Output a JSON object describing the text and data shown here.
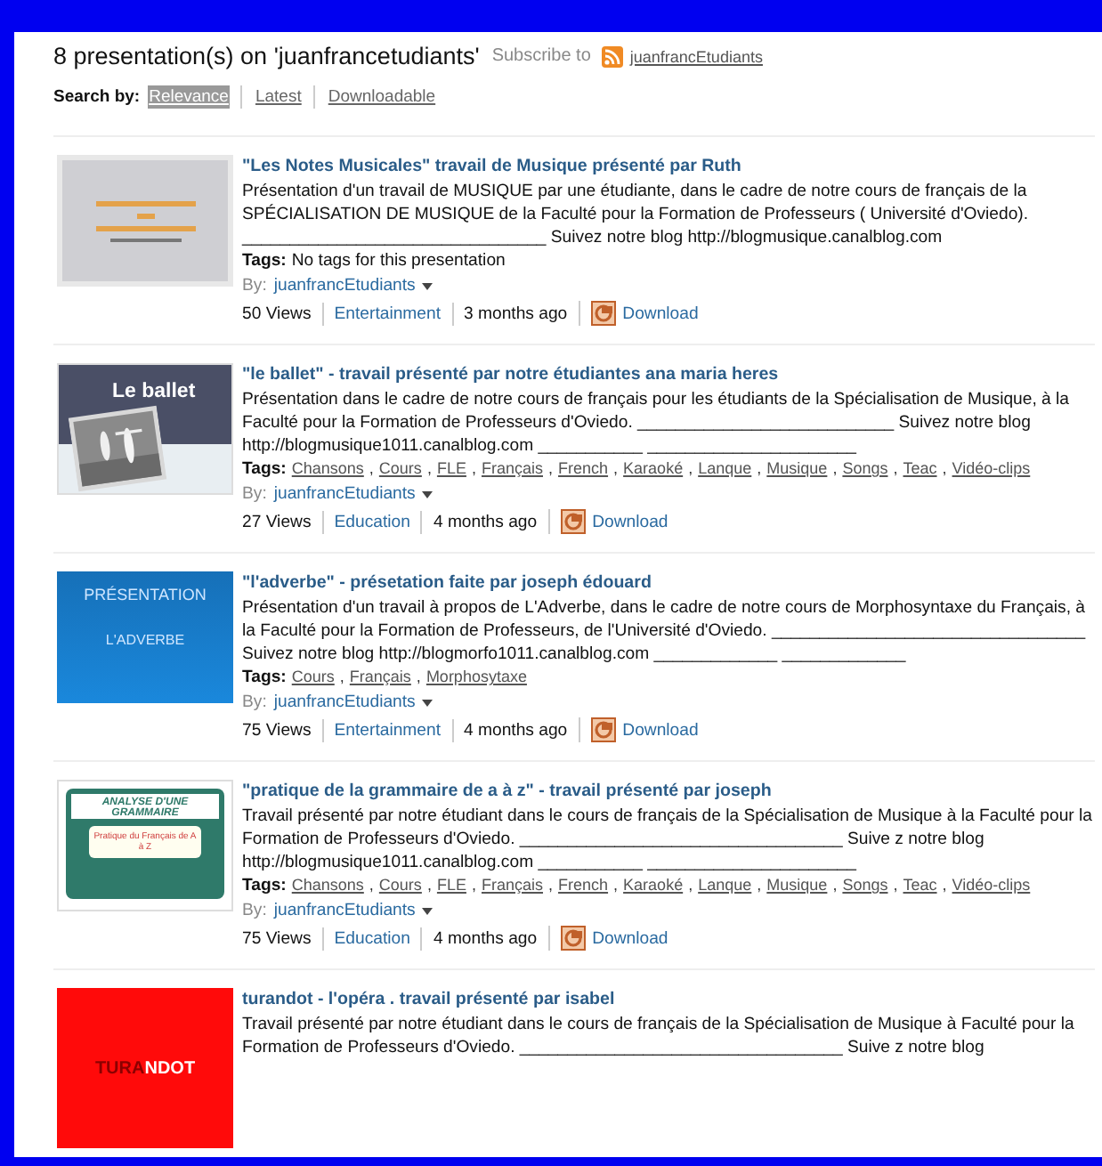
{
  "header": {
    "heading": "8 presentation(s) on 'juanfrancetudiants'",
    "subscribe_label": "Subscribe to",
    "subscribe_link": "juanfrancEtudiants"
  },
  "search": {
    "label": "Search by:",
    "options": [
      {
        "label": "Relevance",
        "selected": true
      },
      {
        "label": "Latest",
        "selected": false
      },
      {
        "label": "Downloadable",
        "selected": false
      }
    ]
  },
  "tag_separator": ",",
  "presentations": [
    {
      "thumb": {
        "kind": "notes"
      },
      "title": "\"Les Notes Musicales\" travail de Musique présenté par Ruth",
      "description": "Présentation d'un travail de MUSIQUE par une étudiante, dans le cadre de notre cours de français de la SPÉCIALISATION DE MUSIQUE de la Faculté pour la Formation de Professeurs ( Université d'Oviedo). ________________________________ Suivez notre blog http://blogmusique.canalblog.com",
      "tags_label": "Tags:",
      "no_tags": "No tags for this presentation",
      "by_label": "By:",
      "author": "juanfrancEtudiants",
      "views": "50 Views",
      "category": "Entertainment",
      "age": "3 months ago",
      "download": "Download"
    },
    {
      "thumb": {
        "kind": "ballet",
        "lines": [
          "Le ballet"
        ]
      },
      "title": "\"le ballet\" - travail présenté par notre étudiantes ana maria heres",
      "description": "Présentation dans le cadre de notre cours de français pour les étudiants de la Spécialisation de Musique, à la Faculté pour la Formation de Professeurs d'Oviedo. ___________________________ Suivez notre blog http://blogmusique1011.canalblog.com ___________ ______________________",
      "tags_label": "Tags:",
      "tags": [
        "Chansons",
        "Cours",
        "FLE",
        "Français",
        "French",
        "Karaoké",
        "Lanque",
        "Musique",
        "Songs",
        "Teac",
        "Vidéo-clips"
      ],
      "by_label": "By:",
      "author": "juanfrancEtudiants",
      "views": "27 Views",
      "category": "Education",
      "age": "4 months ago",
      "download": "Download"
    },
    {
      "thumb": {
        "kind": "blue",
        "lines": [
          "PRÉSENTATION",
          "L'ADVERBE"
        ]
      },
      "title": "\"l'adverbe\" - présetation faite par joseph édouard",
      "description": "Présentation d'un travail à propos de L'Adverbe, dans le cadre de notre cours de Morphosyntaxe du Français, à la Faculté pour la Formation de Professeurs, de l'Université d'Oviedo. _________________________________ Suivez notre blog http://blogmorfo1011.canalblog.com _____________ _____________",
      "tags_label": "Tags:",
      "tags": [
        "Cours",
        "Français",
        "Morphosytaxe"
      ],
      "by_label": "By:",
      "author": "juanfrancEtudiants",
      "views": "75 Views",
      "category": "Entertainment",
      "age": "4 months ago",
      "download": "Download"
    },
    {
      "thumb": {
        "kind": "grammar",
        "lines": [
          "ANALYSE D'UNE GRAMMAIRE",
          "Pratique du Français de A à Z"
        ]
      },
      "title": "\"pratique de la grammaire de a à z\" - travail présenté par joseph",
      "description": "Travail présenté par notre étudiant dans le cours de français de la Spécialisation de Musique à la Faculté pour la Formation de Professeurs d'Oviedo. __________________________________ Suive z notre blog http://blogmusique1011.canalblog.com ___________ ______________________",
      "tags_label": "Tags:",
      "tags": [
        "Chansons",
        "Cours",
        "FLE",
        "Français",
        "French",
        "Karaoké",
        "Lanque",
        "Musique",
        "Songs",
        "Teac",
        "Vidéo-clips"
      ],
      "by_label": "By:",
      "author": "juanfrancEtudiants",
      "views": "75 Views",
      "category": "Education",
      "age": "4 months ago",
      "download": "Download"
    },
    {
      "thumb": {
        "kind": "red",
        "parts": [
          {
            "text": "TURA",
            "color": "#8b0000"
          },
          {
            "text": "NDOT",
            "color": "#ffffff"
          }
        ]
      },
      "title": "turandot - l'opéra . travail présenté par isabel",
      "description": "Travail présenté par notre étudiant dans le cours de français de la Spécialisation de Musique à Faculté pour la Formation de Professeurs d'Oviedo. __________________________________ Suive z notre blog"
    }
  ]
}
